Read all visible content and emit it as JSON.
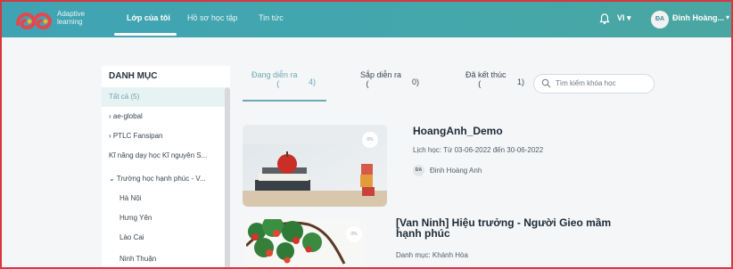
{
  "header": {
    "logo_text_line1": "Adaptive",
    "logo_text_line2": "learning",
    "nav": [
      {
        "label": "Lớp của tôi"
      },
      {
        "label": "Hồ sơ học tập"
      },
      {
        "label": "Tin tức"
      }
    ],
    "language": "VI ▾",
    "user_initials": "ĐA",
    "user_name": "Đinh Hoàng...",
    "user_caret": "▾"
  },
  "sidebar": {
    "title": "DANH MỤC",
    "items": [
      {
        "label": "Tất cả (5)"
      },
      {
        "label": "›  ae-global"
      },
      {
        "label": "›  PTLC Fansipan"
      },
      {
        "label": "Kĩ năng dạy học Kĩ nguyên S..."
      },
      {
        "label": "⌄  Trường học hạnh phúc - V..."
      },
      {
        "label": "Hà Nội"
      },
      {
        "label": "Hưng Yên"
      },
      {
        "label": "Lào Cai"
      },
      {
        "label": "Ninh Thuận"
      }
    ]
  },
  "tabs": [
    {
      "label": "Đang diễn ra",
      "count": "4)",
      "paren": "("
    },
    {
      "label": "Sắp diễn ra",
      "count": "0)",
      "paren": "("
    },
    {
      "label": "Đã kết thúc",
      "count": "1)",
      "paren": "("
    }
  ],
  "search": {
    "placeholder": "Tìm kiếm khóa học"
  },
  "courses": [
    {
      "progress": "0%",
      "title": "HoangAnh_Demo",
      "schedule": "Lịch học: Từ 03-06-2022 đến 30-06-2022",
      "teacher_initials": "ĐA",
      "teacher": "Đinh Hoàng Anh"
    },
    {
      "progress": "0%",
      "title_line1": "[Van Ninh] Hiệu trưởng - Người Gieo mầm",
      "title_line2": "hạnh phúc",
      "category": "Danh mục: Khánh Hòa"
    }
  ],
  "colors": {
    "header": "#44a7ac",
    "accent": "#6fa9b3",
    "frame_border": "#d9363e"
  }
}
